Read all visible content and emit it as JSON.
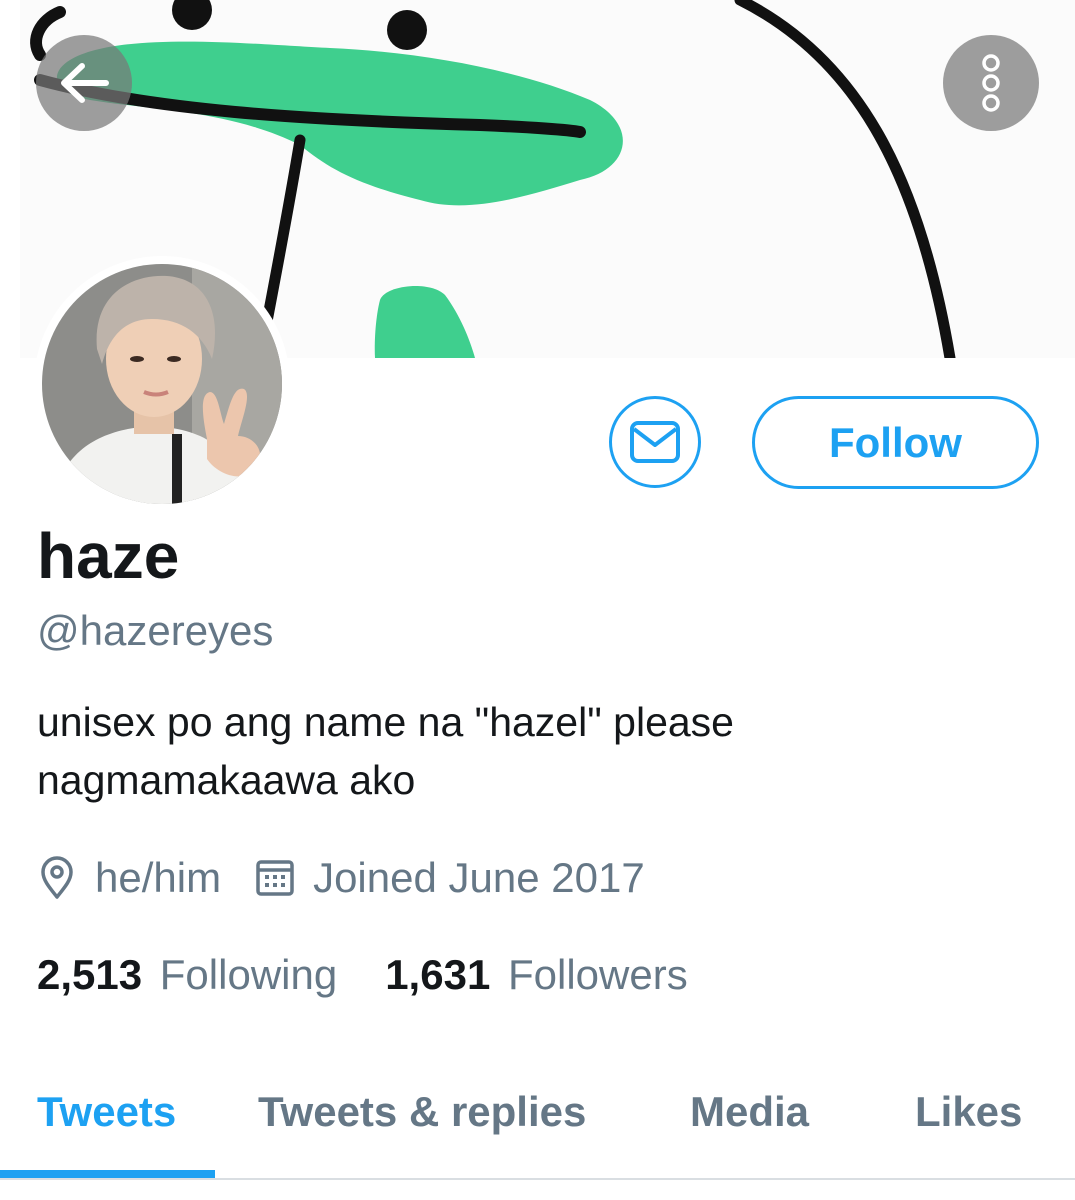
{
  "colors": {
    "accent": "#1da1f2",
    "text_primary": "#14171a",
    "text_secondary": "#657786",
    "banner_green": "#3fcf8e"
  },
  "header": {
    "back_icon": "arrow-left-icon",
    "more_icon": "more-vertical-icon"
  },
  "actions": {
    "message_icon": "envelope-icon",
    "follow_label": "Follow"
  },
  "profile": {
    "name": "haze",
    "handle": "@hazereyes",
    "bio_line1": "unisex po ang name na \"hazel\" please",
    "bio_line2": "nagmamakaawa ako",
    "location": "he/him",
    "joined": "Joined June 2017"
  },
  "stats": {
    "following_count": "2,513",
    "following_label": "Following",
    "followers_count": "1,631",
    "followers_label": "Followers"
  },
  "tabs": [
    {
      "label": "Tweets",
      "active": true
    },
    {
      "label": "Tweets & replies",
      "active": false
    },
    {
      "label": "Media",
      "active": false
    },
    {
      "label": "Likes",
      "active": false
    }
  ]
}
